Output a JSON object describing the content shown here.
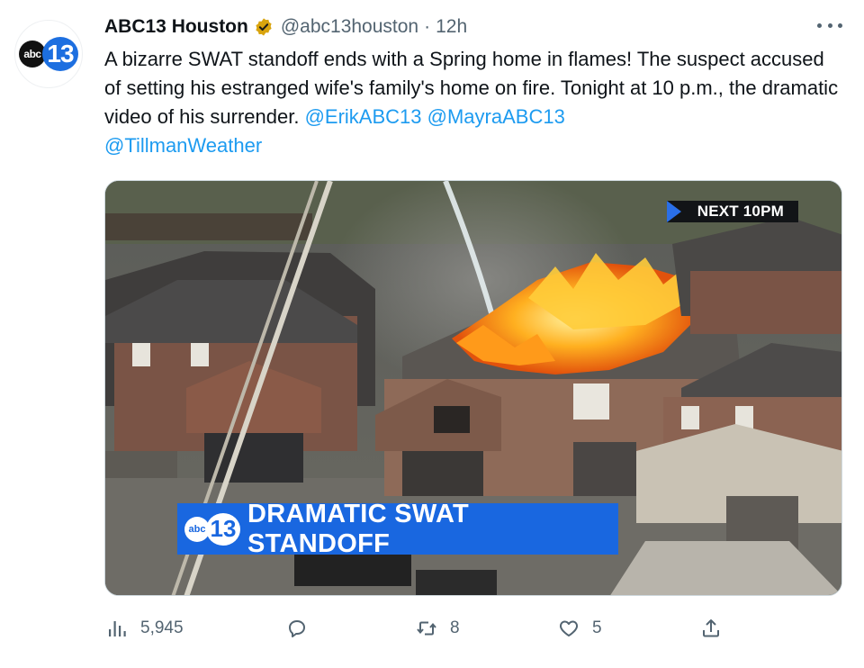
{
  "account": {
    "display_name": "ABC13 Houston",
    "handle": "@abc13houston",
    "separator": "·",
    "time": "12h",
    "logo_abc": "abc",
    "logo_num": "13"
  },
  "tweet": {
    "text": "A bizarre SWAT standoff ends with a Spring home in flames! The suspect accused of setting his estranged wife's family's home on fire. Tonight at 10 p.m., the dramatic video of his surrender. ",
    "mentions": [
      "@ErikABC13",
      "@MayraABC13",
      "@TillmanWeather"
    ]
  },
  "media": {
    "next_badge": "NEXT 10PM",
    "lower_third_logo_abc": "abc",
    "lower_third_logo_num": "13",
    "lower_third_text": "DRAMATIC SWAT STANDOFF",
    "accent_color": "#1967e0"
  },
  "actions": {
    "views": "5,945",
    "replies": "",
    "retweets": "8",
    "likes": "5"
  },
  "icons": [
    "verified-badge-icon",
    "more-icon",
    "views-icon",
    "reply-icon",
    "retweet-icon",
    "like-icon",
    "share-icon"
  ],
  "colors": {
    "link": "#1d9bf0",
    "muted": "#536471",
    "text": "#0f1419"
  }
}
